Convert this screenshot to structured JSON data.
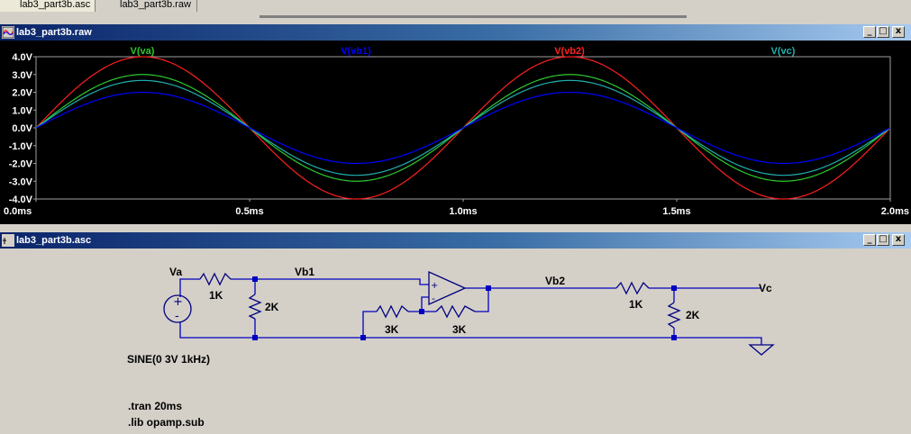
{
  "tabs": [
    {
      "label": "lab3_part3b.asc",
      "active": true
    },
    {
      "label": "lab3_part3b.raw",
      "active": false
    }
  ],
  "plot_window": {
    "title": "lab3_part3b.raw",
    "buttons": {
      "minimize": "_",
      "maximize": "□",
      "close": "x"
    }
  },
  "schematic_window": {
    "title": "lab3_part3b.asc",
    "buttons": {
      "minimize": "_",
      "maximize": "□",
      "close": "x"
    }
  },
  "colors": {
    "va": "#2ec82e",
    "vb1": "#0000ff",
    "vb2": "#ff2020",
    "vc": "#20b0b0",
    "wire": "#0000c0",
    "component": "#000080"
  },
  "chart_data": {
    "type": "line",
    "x": [
      0,
      0.05,
      0.1,
      0.15,
      0.2,
      0.25,
      0.3,
      0.35,
      0.4,
      0.45,
      0.5,
      0.55,
      0.6,
      0.65,
      0.7,
      0.75,
      0.8,
      0.85,
      0.9,
      0.95,
      1.0,
      1.05,
      1.1,
      1.15,
      1.2,
      1.25,
      1.3,
      1.35,
      1.4,
      1.45,
      1.5,
      1.55,
      1.6,
      1.65,
      1.7,
      1.75,
      1.8,
      1.85,
      1.9,
      1.95,
      2.0
    ],
    "series": [
      {
        "name": "V(va)",
        "amplitude": 3,
        "frequency_khz": 1
      },
      {
        "name": "V(vb1)",
        "amplitude": 2,
        "frequency_khz": 1
      },
      {
        "name": "V(vb2)",
        "amplitude": 4,
        "frequency_khz": 1
      },
      {
        "name": "V(vc)",
        "amplitude": 2.667,
        "frequency_khz": 1
      }
    ],
    "xlabel": "",
    "ylabel": "",
    "xlim": [
      0,
      2.0
    ],
    "ylim": [
      -4.0,
      4.0
    ],
    "x_ticks": [
      "0.0ms",
      "0.5ms",
      "1.0ms",
      "1.5ms",
      "2.0ms"
    ],
    "y_ticks": [
      "4.0V",
      "3.0V",
      "2.0V",
      "1.0V",
      "0.0V",
      "-1.0V",
      "-2.0V",
      "-3.0V",
      "-4.0V"
    ],
    "grid": false,
    "legend_placement": "top"
  },
  "schematic": {
    "labels": {
      "va": "Va",
      "vb1": "Vb1",
      "vb2": "Vb2",
      "vc": "Vc",
      "r1": "1K",
      "r2": "2K",
      "r3": "3K",
      "r4": "3K",
      "r5": "1K",
      "r6": "2K",
      "plus": "+",
      "minus": "-"
    },
    "source_value": "SINE(0 3V 1kHz)",
    "directives": [
      ".tran 20ms",
      ".lib opamp.sub"
    ]
  }
}
